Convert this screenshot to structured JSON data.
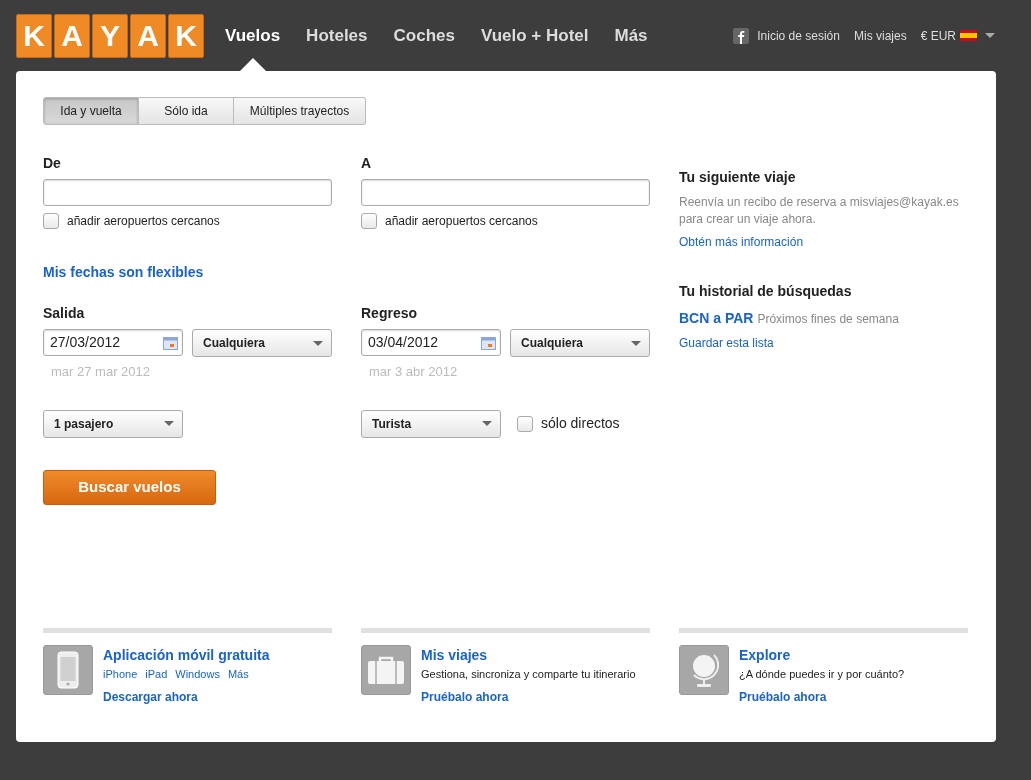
{
  "logo": {
    "letters": [
      "K",
      "A",
      "Y",
      "A",
      "K"
    ]
  },
  "nav": [
    {
      "label": "Vuelos",
      "selected": true
    },
    {
      "label": "Hoteles",
      "selected": false
    },
    {
      "label": "Coches",
      "selected": false
    },
    {
      "label": "Vuelo + Hotel",
      "selected": false
    },
    {
      "label": "Más",
      "selected": false
    }
  ],
  "account": {
    "login": "Inicio de sesión",
    "trips": "Mis viajes",
    "currency": "€ EUR"
  },
  "trip_types": [
    {
      "label": "Ida y vuelta",
      "selected": true
    },
    {
      "label": "Sólo ida",
      "selected": false
    },
    {
      "label": "Múltiples trayectos",
      "selected": false
    }
  ],
  "from": {
    "label": "De",
    "nearby": {
      "label": "añadir aeropuertos cercanos",
      "checked": false
    }
  },
  "to": {
    "label": "A",
    "nearby": {
      "label": "añadir aeropuertos cercanos",
      "checked": false
    }
  },
  "flexible_link": "Mis fechas son flexibles",
  "departure": {
    "label": "Salida",
    "date": "27/03/2012",
    "flex": "Cualquiera",
    "date_text": "mar 27 mar 2012"
  },
  "return": {
    "label": "Regreso",
    "date": "03/04/2012",
    "flex": "Cualquiera",
    "date_text": "mar 3 abr 2012"
  },
  "passengers": "1 pasajero",
  "cabin": "Turista",
  "nonstop": {
    "label": "sólo directos",
    "checked": false
  },
  "search_button": "Buscar vuelos",
  "next_trip": {
    "title": "Tu siguiente viaje",
    "text": "Reenvía un recibo de reserva a misviajes@kayak.es para crear un viaje ahora.",
    "link": "Obtén más información"
  },
  "history": {
    "title": "Tu historial de búsquedas",
    "items": [
      {
        "route": "BCN a PAR",
        "note": "Próximos fines de semana"
      }
    ],
    "link": "Guardar esta lista"
  },
  "promos": [
    {
      "kind": "phone",
      "title": "Aplicación móvil gratuita",
      "links": [
        "iPhone",
        "iPad",
        "Windows",
        "Más"
      ],
      "action": "Descargar ahora"
    },
    {
      "kind": "suitcase",
      "title": "Mis viajes",
      "text": "Gestiona, sincroniza y comparte tu itinerario",
      "action": "Pruébalo ahora"
    },
    {
      "kind": "globe",
      "title": "Explore",
      "text": "¿A dónde puedes ir y por cuánto?",
      "action": "Pruébalo ahora"
    }
  ]
}
